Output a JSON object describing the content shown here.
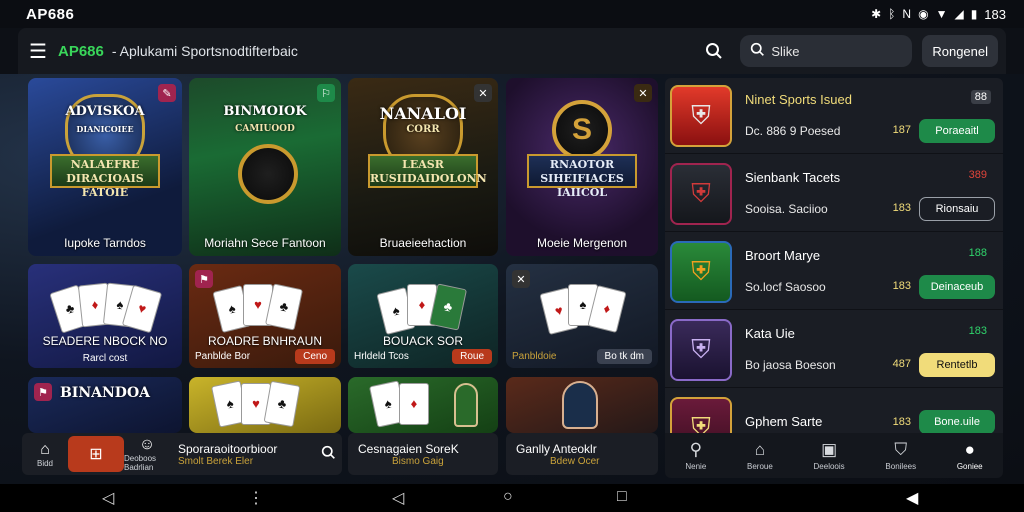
{
  "status_bar": {
    "app_name": "AP686",
    "time": "183",
    "icons": [
      "bluetooth-icon",
      "nfc-icon",
      "mute-icon",
      "signal-icon",
      "wifi-icon",
      "battery-icon"
    ]
  },
  "app_bar": {
    "brand": "AP686",
    "title": "- Aplukami Sportsnodtifterbaic",
    "search_placeholder": "Slike",
    "register_label": "Rongenel"
  },
  "grid": {
    "row1": [
      {
        "caption": "Iupoke Tarndos",
        "emblem_top": "ADVISKOA",
        "emblem_bottom": "NALAEFRE DIRACIOAIS FATOIE",
        "emblem_label_small": "DIANICOIEE"
      },
      {
        "caption": "Moriahn Sece Fantoon",
        "emblem_top": "BINMOIOK",
        "emblem_bottom": "",
        "emblem_label_small": "CAMIUOOD"
      },
      {
        "caption": "Bruaeieehaction",
        "emblem_top": "NANALOI",
        "emblem_bottom": "LEASR RUSIIDAIDOLONN",
        "emblem_label_small": "CORR"
      },
      {
        "caption": "Moeie Mergenon",
        "emblem_top": "",
        "emblem_bottom": "RNAOTOR SIHEIFIACES IAIICOL",
        "emblem_label_small": ""
      }
    ],
    "row2": [
      {
        "caption": "SEADERE NBOCK NO",
        "sub": "Rarcl cost"
      },
      {
        "caption": "ROADRE BNHRAUN",
        "sub": "Panblde Bor",
        "btn": "Ceno"
      },
      {
        "caption": "BOUACK SOR",
        "sub": "Hrldeld Tcos",
        "btn": "Roue"
      },
      {
        "caption": "",
        "sub": "Panbldoie",
        "btn": "Bo tk dm"
      }
    ],
    "row3_emblem": "BINANDOA"
  },
  "bottom_strip": {
    "left_items": [
      {
        "label": "Bidd",
        "icon": "home-icon"
      },
      {
        "label": "",
        "icon": "casino-icon"
      },
      {
        "label": "Deoboos Badrlian",
        "icon": "profile-icon"
      }
    ],
    "left_title": "Sporaraoitoorbioor",
    "left_sub": "Smolt Berek Eler",
    "mid_title": "Cesnagaien SoreK",
    "mid_sub": "Bismo Gaig",
    "right_title": "Ganlly Anteoklr",
    "right_sub": "Bdew Ocer"
  },
  "side_list": [
    {
      "name": "Ninet Sports Isued",
      "meta": "Dc. 886 9 Poesed",
      "odds": "187",
      "badge": "88",
      "btn": "Poraeaitl",
      "btn_style": "green",
      "logo": "shield-red"
    },
    {
      "name": "Sienbank Tacets",
      "meta": "Sooisa. Saciioo",
      "odds": "183",
      "badge": "389",
      "btn": "Rionsaiu",
      "btn_style": "outline",
      "logo": "shield-dark"
    },
    {
      "name": "Broort Marye",
      "meta": "So.locf Saosoo",
      "odds": "183",
      "badge": "188",
      "btn": "Deinaceub",
      "btn_style": "green",
      "logo": "shield-green"
    },
    {
      "name": "Kata Uie",
      "meta": "Bo jaosa Boeson",
      "odds": "487",
      "badge": "183",
      "btn": "Rentetlb",
      "btn_style": "yellow",
      "logo": "shield-purple"
    },
    {
      "name": "Gphem Sarte",
      "meta": "",
      "odds": "183",
      "badge": "",
      "btn": "Bone.uile",
      "btn_style": "green",
      "logo": "shield-maroon"
    }
  ],
  "side_nav": [
    {
      "label": "Nenie",
      "icon": "location-icon"
    },
    {
      "label": "Beroue",
      "icon": "home-icon"
    },
    {
      "label": "Deeloois",
      "icon": "sports-icon"
    },
    {
      "label": "Bonilees",
      "icon": "shield-icon"
    },
    {
      "label": "Goniee",
      "icon": "profile-icon"
    }
  ],
  "colors": {
    "accent_green": "#1e8a49",
    "brand_green": "#39d65a",
    "highlight_yellow": "#f1dc7a",
    "badge_green": "#2fd46b"
  }
}
